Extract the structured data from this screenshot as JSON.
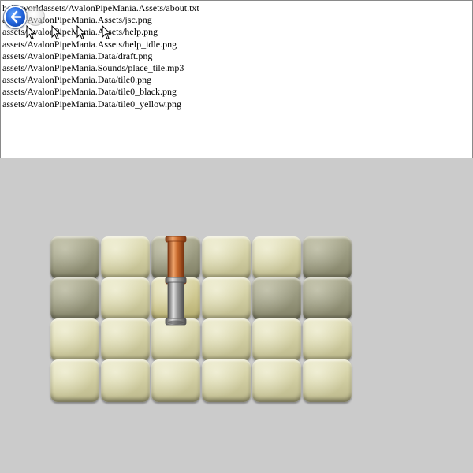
{
  "log": {
    "lines": [
      "helloworldassets/AvalonPipeMania.Assets/about.txt",
      "assets/AvalonPipeMania.Assets/jsc.png",
      "assets/AvalonPipeMania.Assets/help.png",
      "assets/AvalonPipeMania.Assets/help_idle.png",
      "assets/AvalonPipeMania.Data/draft.png",
      "assets/AvalonPipeMania.Sounds/place_tile.mp3",
      "assets/AvalonPipeMania.Data/tile0.png",
      "assets/AvalonPipeMania.Data/tile0_black.png",
      "assets/AvalonPipeMania.Data/tile0_yellow.png"
    ]
  },
  "icons": {
    "back": "back-arrow-icon",
    "forward": "forward-button-icon",
    "cursor": "arrow-cursor-icon"
  },
  "board": {
    "rows": 4,
    "cols": 6,
    "tile_kinds": [
      [
        "dark",
        "light",
        "dark",
        "light",
        "light",
        "dark"
      ],
      [
        "dark",
        "light",
        "yellowish",
        "light",
        "dark",
        "dark"
      ],
      [
        "light",
        "light",
        "light",
        "light",
        "light",
        "light"
      ],
      [
        "light",
        "light",
        "light",
        "light",
        "light",
        "light"
      ]
    ],
    "pipes": [
      {
        "type": "copper-vertical-pipe",
        "row": 0,
        "col": 2
      },
      {
        "type": "steel-vertical-pipe",
        "row": 1,
        "col": 2
      }
    ]
  },
  "colors": {
    "background": "#cbcbcb",
    "panel": "#ffffff",
    "copper": "#c8692c",
    "steel": "#9a9a9a"
  }
}
